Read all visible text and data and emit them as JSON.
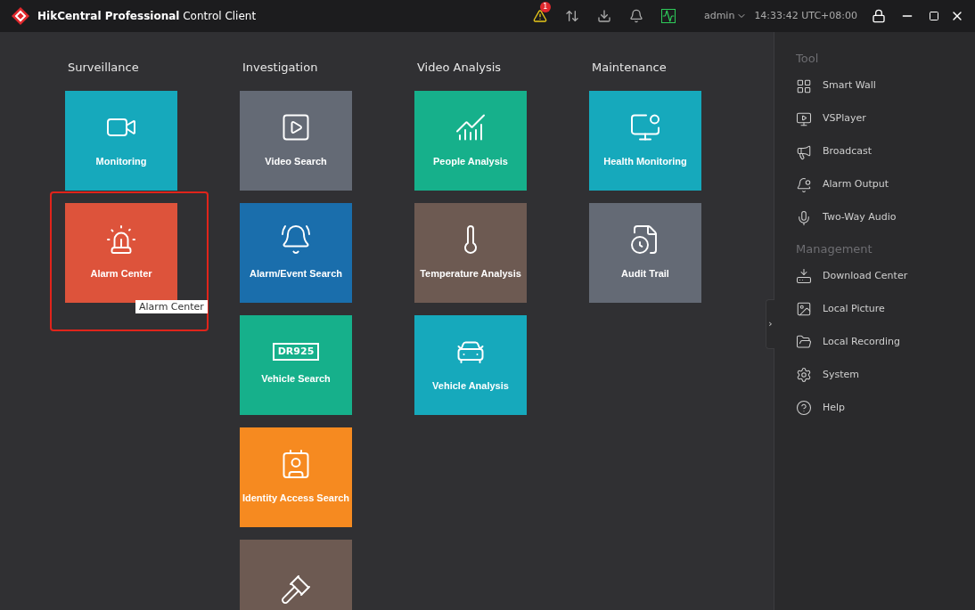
{
  "window": {
    "title_bold": "HikCentral Professional",
    "title_rest": "Control Client"
  },
  "title_bar": {
    "alert_badge": "1",
    "user": "admin",
    "time": "14:33:42 UTC+08:00"
  },
  "columns": [
    {
      "title": "Surveillance",
      "tiles": [
        {
          "label": "Monitoring",
          "color": "#16a9bc",
          "highlighted": false
        },
        {
          "label": "Alarm Center",
          "color": "#dd533b",
          "highlighted": true,
          "tooltip": "Alarm Center"
        }
      ]
    },
    {
      "title": "Investigation",
      "tiles": [
        {
          "label": "Video Search",
          "color": "#646a75",
          "highlighted": false
        },
        {
          "label": "Alarm/Event Search",
          "color": "#1a6eac",
          "highlighted": false
        },
        {
          "label": "Vehicle Search",
          "color": "#16b08b",
          "highlighted": false,
          "icon_text": "DR925"
        },
        {
          "label": "Identity Access Search",
          "color": "#f68a20",
          "highlighted": false
        },
        {
          "color": "#6d5a52",
          "highlighted": false
        }
      ]
    },
    {
      "title": "Video Analysis",
      "tiles": [
        {
          "label": "People Analysis",
          "color": "#16b08b",
          "highlighted": false
        },
        {
          "label": "Temperature Analysis",
          "color": "#6d5a52",
          "highlighted": false
        },
        {
          "label": "Vehicle Analysis",
          "color": "#16a9bc",
          "highlighted": false
        }
      ]
    },
    {
      "title": "Maintenance",
      "tiles": [
        {
          "label": "Health Monitoring",
          "color": "#16a9bc",
          "highlighted": false
        },
        {
          "label": "Audit Trail",
          "color": "#646a75",
          "highlighted": false
        }
      ]
    }
  ],
  "sidebar": {
    "collapse_handle": "›",
    "sections": [
      {
        "title": "Tool",
        "items": [
          "Smart Wall",
          "VSPlayer",
          "Broadcast",
          "Alarm Output",
          "Two-Way Audio"
        ]
      },
      {
        "title": "Management",
        "items": [
          "Download Center",
          "Local Picture",
          "Local Recording",
          "System",
          "Help"
        ]
      }
    ]
  }
}
